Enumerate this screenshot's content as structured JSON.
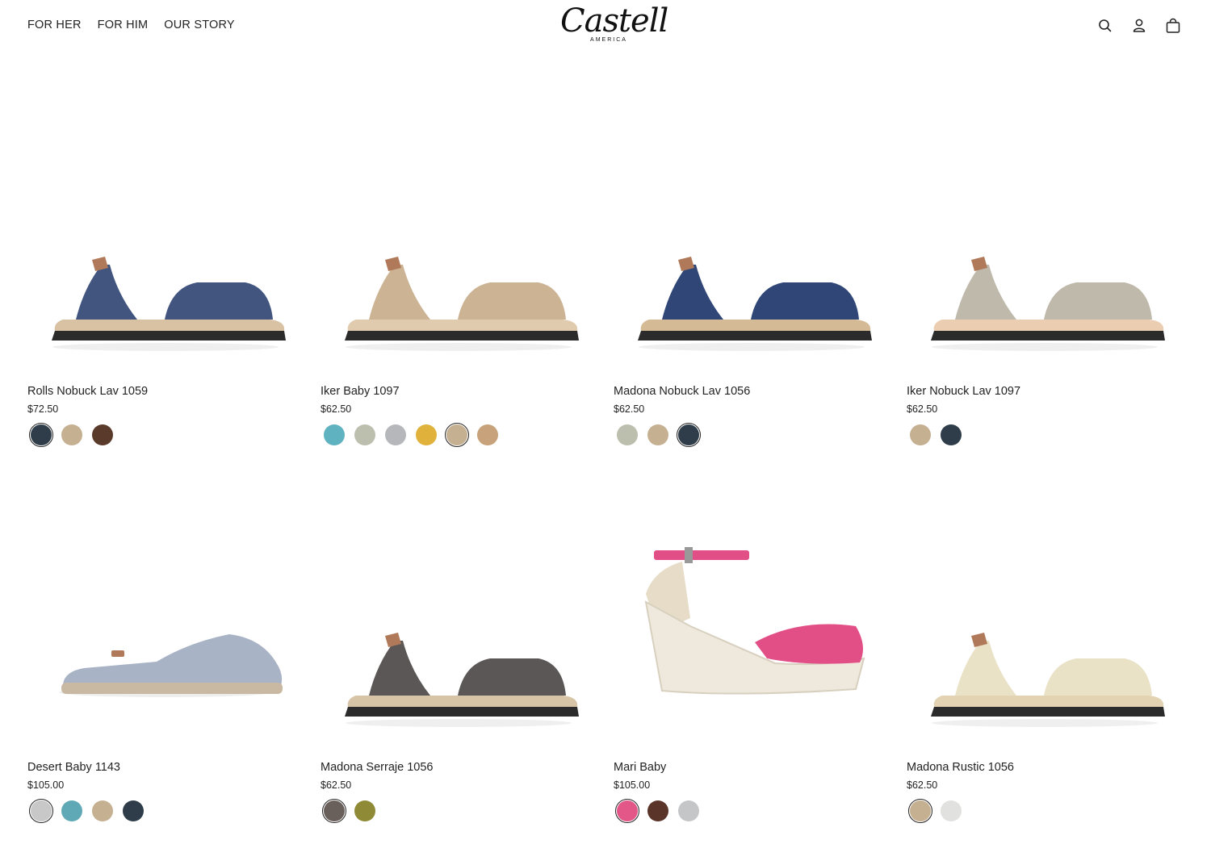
{
  "header": {
    "nav": [
      "FOR HER",
      "FOR HIM",
      "OUR STORY"
    ],
    "logo_word": "Castell",
    "logo_sub": "AMERICA",
    "icons": [
      "search-icon",
      "account-icon",
      "bag-icon"
    ]
  },
  "products": [
    {
      "title": "Rolls Nobuck Lav 1059",
      "price": "$72.50",
      "upper": "#41557f",
      "sole": "#d8c2a3",
      "swatches": [
        "#2f3d4b",
        "#c6b092",
        "#5a3a2a"
      ],
      "selected": 0
    },
    {
      "title": "Iker Baby 1097",
      "price": "$62.50",
      "upper": "#cbb394",
      "sole": "#e0cbae",
      "swatches": [
        "#5fb2c0",
        "#bdbfae",
        "#b5b7bb",
        "#e0b23c",
        "#c6b092",
        "#c7a27a"
      ],
      "selected": 4
    },
    {
      "title": "Madona Nobuck Lav 1056",
      "price": "$62.50",
      "upper": "#2f4676",
      "sole": "#d4bb96",
      "swatches": [
        "#bdbfae",
        "#c6b092",
        "#2f3d4b"
      ],
      "selected": 2
    },
    {
      "title": "Iker Nobuck Lav 1097",
      "price": "$62.50",
      "upper": "#bfb9ab",
      "sole": "#ebcdb2",
      "swatches": [
        "#c6b092",
        "#2f3d4b"
      ],
      "selected": null
    },
    {
      "title": "Desert Baby 1143",
      "price": "$105.00",
      "upper": "#a9b3c6",
      "sole": "#c9b9a2",
      "swatches": [
        "#c8c8c8",
        "#5fa9b6",
        "#c6b092",
        "#2f3d4b"
      ],
      "selected": 0
    },
    {
      "title": "Madona Serraje 1056",
      "price": "$62.50",
      "upper": "#5b5757",
      "sole": "#d7c4a6",
      "swatches": [
        "#6a605b",
        "#8e8a35"
      ],
      "selected": 0
    },
    {
      "title": "Mari Baby",
      "price": "$105.00",
      "upper": "#e14f86",
      "sole": "#eee9dc",
      "swatches": [
        "#e25688",
        "#5a3428",
        "#c5c6c8"
      ],
      "selected": 0
    },
    {
      "title": "Madona Rustic 1056",
      "price": "$62.50",
      "upper": "#e9e2c6",
      "sole": "#e3d3b3",
      "swatches": [
        "#c6b092",
        "#e1e1df"
      ],
      "selected": 0
    }
  ]
}
